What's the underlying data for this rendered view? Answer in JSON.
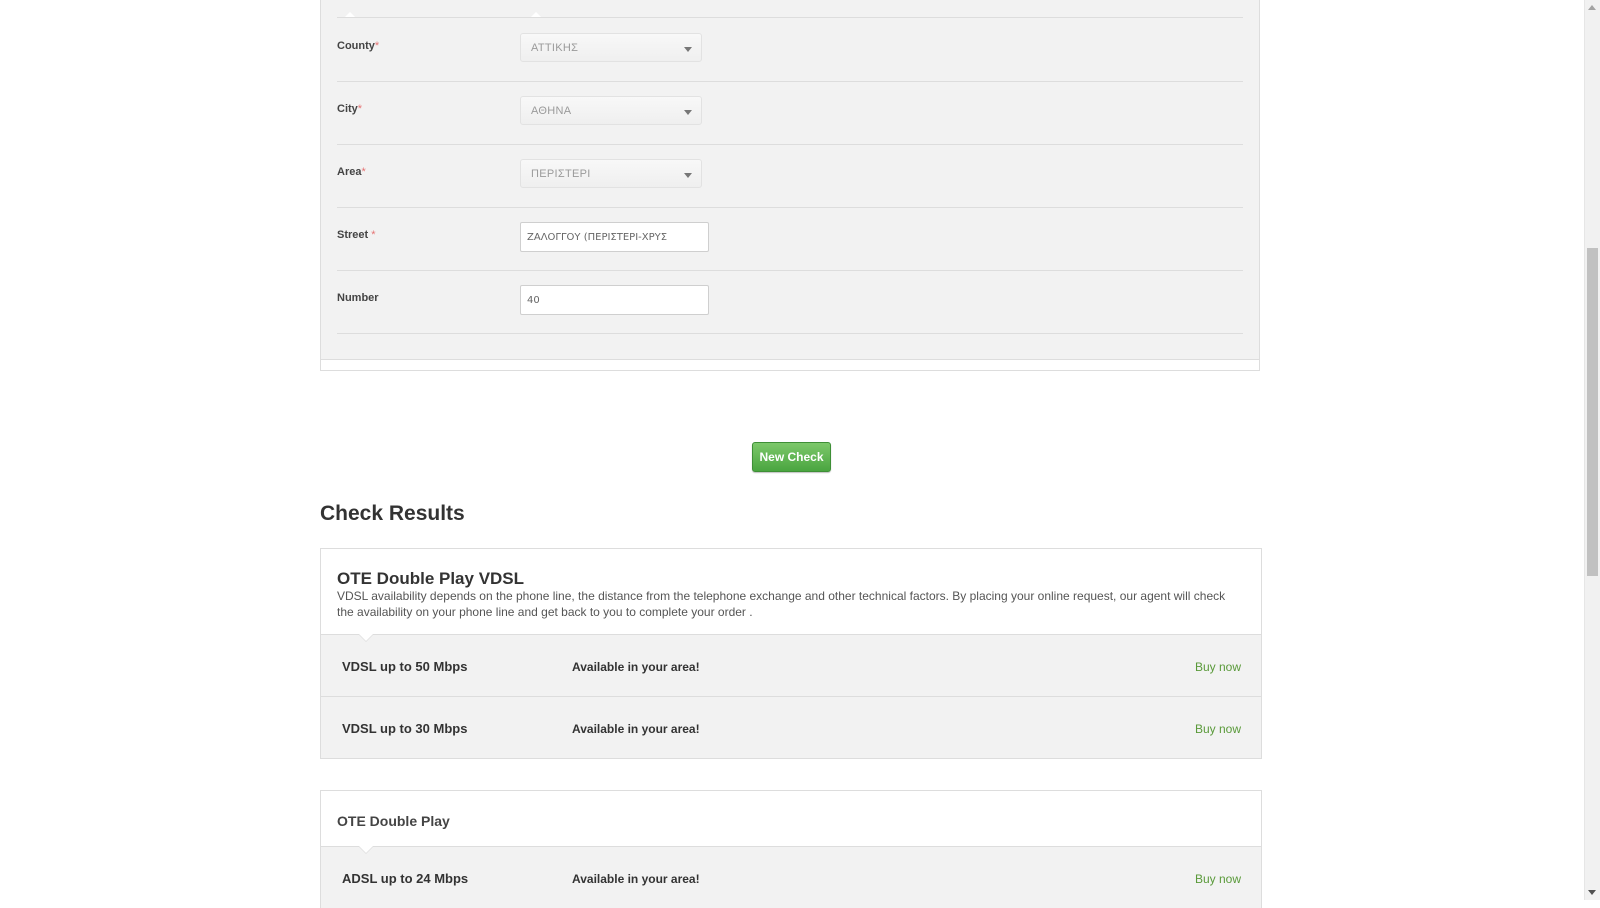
{
  "form": {
    "rows": [
      {
        "label": "County",
        "required_mark": "*",
        "type": "select",
        "value": "ΑΤΤΙΚΗΣ"
      },
      {
        "label": "City",
        "required_mark": "*",
        "type": "select",
        "value": "ΑΘΗΝΑ"
      },
      {
        "label": "Area",
        "required_mark": "*",
        "type": "select",
        "value": "ΠΕΡΙΣΤΕΡΙ"
      },
      {
        "label": "Street ",
        "required_mark": "*",
        "type": "text",
        "value": "ΖΑΛΟΓΓΟΥ (ΠΕΡΙΣΤΕΡΙ-ΧΡΥΣ"
      },
      {
        "label": "Number",
        "required_mark": "",
        "type": "text",
        "value": "40"
      }
    ]
  },
  "new_check_label": "New Check",
  "results_title": "Check Results",
  "results": [
    {
      "title": "OTE Double Play VDSL",
      "description": "VDSL availability depends on the phone line, the distance from the telephone exchange and other technical factors. By placing your online request, our agent will check the availability on your phone line and get back to you to complete your order .",
      "offers": [
        {
          "name": "VDSL up to 50 Mbps",
          "availability": "Available in your area!",
          "action": "Buy now"
        },
        {
          "name": "VDSL up to 30 Mbps",
          "availability": "Available in your area!",
          "action": "Buy now"
        }
      ]
    },
    {
      "title": "OTE Double Play",
      "description": "",
      "offers": [
        {
          "name": "ADSL up to 24 Mbps",
          "availability": "Available in your area!",
          "action": "Buy now"
        }
      ]
    }
  ],
  "colors": {
    "button_green": "#4aa540",
    "link_green": "#5a9a3a",
    "required_red": "#e57373",
    "panel_bg": "#f2f2f2"
  }
}
